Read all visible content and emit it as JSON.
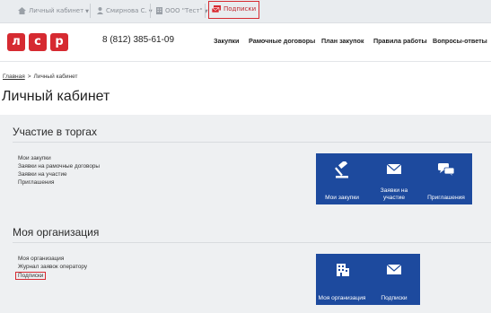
{
  "topbar": {
    "cabinet_label": "Личный кабинет",
    "user_label": "Смирнова С.",
    "org_label": "ООО \"Тест\"",
    "subscriptions_label": "Подписки"
  },
  "header": {
    "logo_letters": [
      "л",
      "с",
      "р"
    ],
    "phone": "8 (812) 385-61-09",
    "nav": [
      "Закупки",
      "Рамочные договоры",
      "План закупок",
      "Правила работы",
      "Вопросы-ответы"
    ]
  },
  "breadcrumb": {
    "home": "Главная",
    "separator": ">",
    "current": "Личный кабинет"
  },
  "page_title": "Личный кабинет",
  "sections": {
    "trading": {
      "title": "Участие в торгах",
      "links": [
        "Мои закупки",
        "Заявки на рамочные договоры",
        "Заявки на участие",
        "Приглашения"
      ],
      "tiles": [
        "Мои закупки",
        "Заявки на участие",
        "Приглашения"
      ]
    },
    "org": {
      "title": "Моя организация",
      "links": [
        "Моя организация",
        "Журнал заявок оператору",
        "Подписки"
      ],
      "tiles": [
        "Моя организация",
        "Подписки"
      ]
    }
  },
  "colors": {
    "accent_red": "#d62a31",
    "tile_blue": "#1d4a9e",
    "topbar_bg": "#e9ecef",
    "panel_bg": "#eef0f2"
  },
  "icons": {
    "tile_purchases": "gavel-icon",
    "tile_applications": "envelope-icon",
    "tile_invitations": "chat-bubbles-icon",
    "tile_org": "building-icon",
    "tile_subscriptions": "envelope-icon"
  }
}
